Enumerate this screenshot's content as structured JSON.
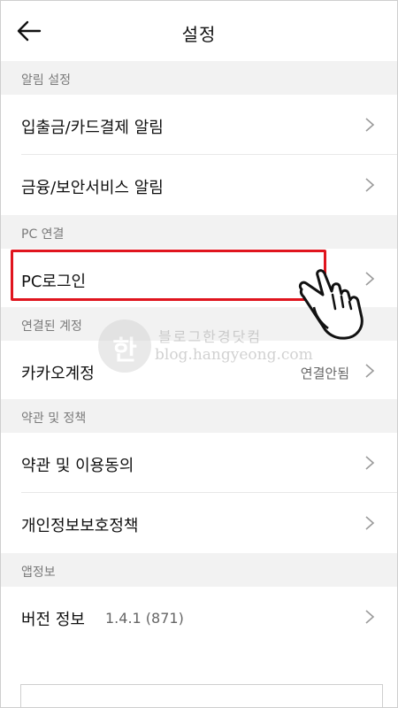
{
  "header": {
    "title": "설정",
    "back_icon": "arrow-left-icon"
  },
  "sections": [
    {
      "title": "알림 설정",
      "items": [
        {
          "label": "입출금/카드결제 알림"
        },
        {
          "label": "금융/보안서비스 알림"
        }
      ]
    },
    {
      "title": "PC 연결",
      "items": [
        {
          "label": "PC로그인"
        }
      ]
    },
    {
      "title": "연결된 계정",
      "items": [
        {
          "label": "카카오계정",
          "value": "연결안됨"
        }
      ]
    },
    {
      "title": "약관 및 정책",
      "items": [
        {
          "label": "약관 및 이용동의"
        },
        {
          "label": "개인정보보호정책"
        }
      ]
    },
    {
      "title": "앱정보",
      "items": [
        {
          "label": "버전 정보",
          "value": "1.4.1 (871)"
        }
      ]
    }
  ],
  "watermark": {
    "text_ko": "블로그한경닷컴",
    "text_en": "blog.hangyeong.com"
  },
  "colors": {
    "highlight": "#e0151e",
    "section_bg": "#f2f2f2"
  }
}
